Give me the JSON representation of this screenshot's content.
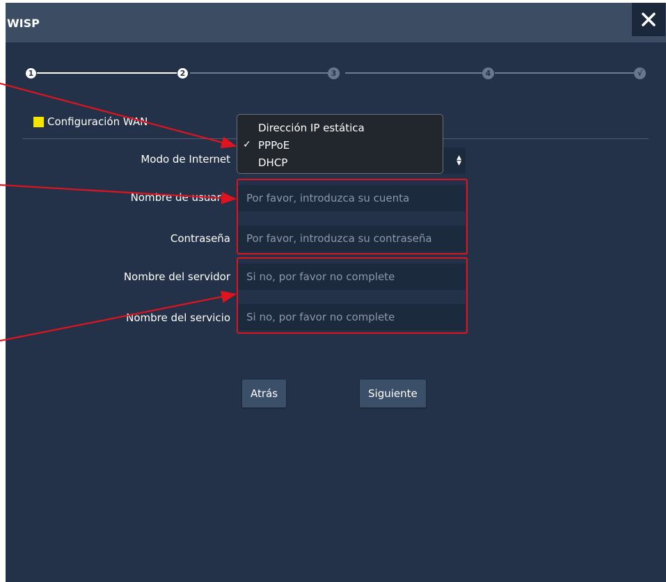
{
  "dialog": {
    "title": "WISP",
    "close_icon": "close-icon"
  },
  "steps": [
    "1",
    "2",
    "3",
    "4",
    "√"
  ],
  "current_step": 2,
  "section": {
    "title": "Configuración WAN"
  },
  "form": {
    "internet_mode": {
      "label": "Modo de Internet",
      "options": [
        "Dirección IP estática",
        "PPPoE",
        "DHCP"
      ],
      "selected": "PPPoE"
    },
    "username": {
      "label": "Nombre de usuario",
      "placeholder": "Por favor, introduzca su cuenta",
      "value": ""
    },
    "password": {
      "label": "Contraseña",
      "placeholder": "Por favor, introduzca su contraseña",
      "value": ""
    },
    "server_name": {
      "label": "Nombre del servidor",
      "placeholder": "Si no, por favor no complete",
      "value": ""
    },
    "service_name": {
      "label": "Nombre del servicio",
      "placeholder": "Si no, por favor no complete",
      "value": ""
    }
  },
  "buttons": {
    "back": "Atrás",
    "next": "Siguiente"
  },
  "colors": {
    "annotation": "#e0141e",
    "accent_square": "#f5e600",
    "background": "#233249",
    "titlebar": "#3b4c63"
  }
}
